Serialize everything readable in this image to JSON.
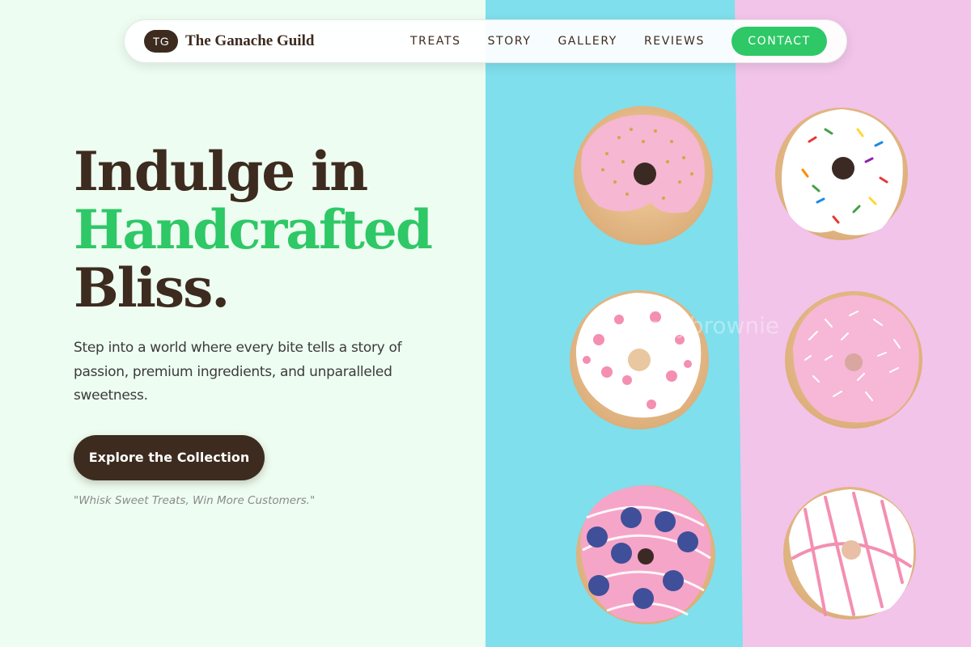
{
  "nav": {
    "logo_badge": "TG",
    "brand_name": "The Ganache Guild",
    "links": [
      "TREATS",
      "STORY",
      "GALLERY",
      "REVIEWS"
    ],
    "cta": "CONTACT"
  },
  "hero": {
    "line1": "Indulge in",
    "line2": "Handcrafted",
    "line3": "Bliss.",
    "description": "Step into a world where every bite tells a story of passion, premium ingredients, and unparalleled sweetness.",
    "button": "Explore the Collection",
    "tagline": "\"Whisk Sweet Treats, Win More Customers.\""
  },
  "photo": {
    "watermark": "funnybrownie"
  },
  "colors": {
    "brown": "#3d2b1f",
    "green": "#2ec866",
    "background": "#eefdf1",
    "teal": "#7fdfed",
    "pink": "#f2c4ea"
  }
}
